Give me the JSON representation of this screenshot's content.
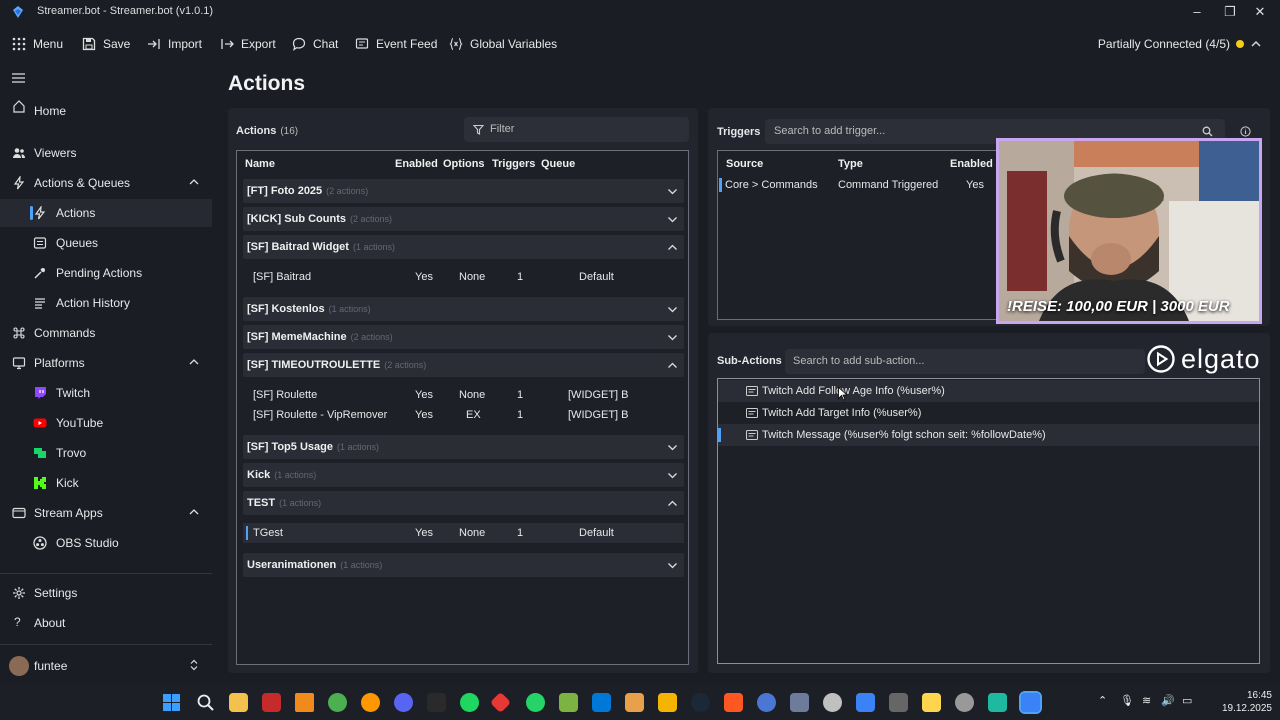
{
  "window": {
    "title": "Streamer.bot - Streamer.bot (v1.0.1)"
  },
  "toolbar": {
    "menu": "Menu",
    "save": "Save",
    "import": "Import",
    "export": "Export",
    "chat": "Chat",
    "event_feed": "Event Feed",
    "global_vars": "Global Variables",
    "connection": "Partially Connected (4/5)"
  },
  "sidebar": {
    "items": [
      "Home",
      "Viewers",
      "Actions & Queues",
      "Actions",
      "Queues",
      "Pending Actions",
      "Action History",
      "Commands",
      "Platforms",
      "Twitch",
      "YouTube",
      "Trovo",
      "Kick",
      "Stream Apps",
      "OBS Studio",
      "Settings",
      "About"
    ],
    "user": "funtee"
  },
  "page": {
    "title": "Actions"
  },
  "actions": {
    "label": "Actions",
    "count": "(16)",
    "filter_placeholder": "Filter",
    "columns": [
      "Name",
      "Enabled",
      "Options",
      "Triggers",
      "Queue"
    ],
    "groups": [
      {
        "name": "[FT] Foto 2025",
        "meta": "(2 actions)"
      },
      {
        "name": "[KICK] Sub Counts",
        "meta": "(2 actions)"
      },
      {
        "name": "[SF] Baitrad Widget",
        "meta": "(1 actions)"
      },
      {
        "name": "[SF] Kostenlos",
        "meta": "(1 actions)"
      },
      {
        "name": "[SF] MemeMachine",
        "meta": "(2 actions)"
      },
      {
        "name": "[SF] TIMEOUTROULETTE",
        "meta": "(2 actions)"
      },
      {
        "name": "[SF] Top5 Usage",
        "meta": "(1 actions)"
      },
      {
        "name": "Kick",
        "meta": "(1 actions)"
      },
      {
        "name": "TEST",
        "meta": "(1 actions)"
      },
      {
        "name": "Useranimationen",
        "meta": "(1 actions)"
      }
    ],
    "rows": [
      [
        "[SF] Baitrad",
        "Yes",
        "None",
        "1",
        "Default"
      ],
      [
        "[SF] Roulette",
        "Yes",
        "None",
        "1",
        "[WIDGET] B"
      ],
      [
        "[SF] Roulette - VipRemover",
        "Yes",
        "EX",
        "1",
        "[WIDGET] B"
      ],
      [
        "TGest",
        "Yes",
        "None",
        "1",
        "Default"
      ]
    ]
  },
  "triggers": {
    "label": "Triggers",
    "placeholder": "Search to add trigger...",
    "columns": [
      "Source",
      "Type",
      "Enabled"
    ],
    "rows": [
      [
        "Core > Commands",
        "Command Triggered",
        "Yes"
      ]
    ]
  },
  "webcam": {
    "caption": "!REISE: 100,00 EUR | 3000 EUR"
  },
  "subactions": {
    "label": "Sub-Actions",
    "placeholder": "Search to add sub-action...",
    "brand": "elgato",
    "rows": [
      "Twitch Add Follow Age Info (%user%)",
      "Twitch Add Target Info (%user%)",
      "Twitch Message (%user% folgt schon seit: %followDate%)"
    ]
  },
  "taskbar": {
    "time": "16:45",
    "date": "19.12.2025"
  },
  "colors": {
    "accent": "#4fa3f7",
    "status": "#f3cd1a",
    "cam_border": "#c8a6f0"
  }
}
